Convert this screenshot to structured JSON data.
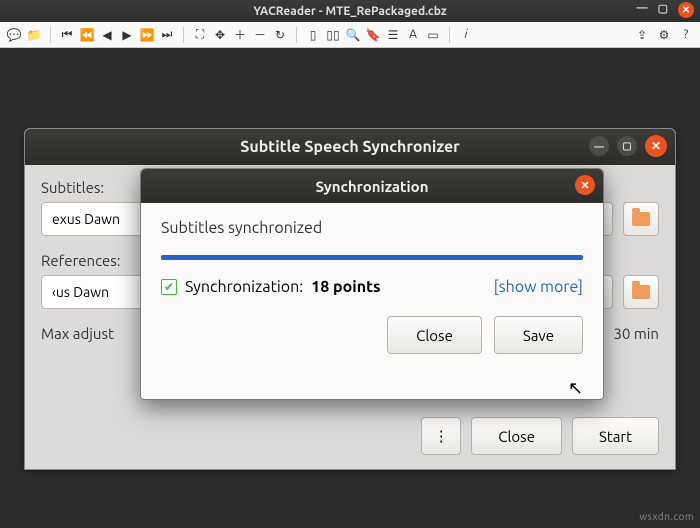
{
  "outer_window": {
    "title": "YACReader - MTE_RePackaged.cbz"
  },
  "sss_window": {
    "title": "Subtitle Speech Synchronizer",
    "subtitles_label": "Subtitles:",
    "subtitles_value": "exus Dawn",
    "references_label": "References:",
    "references_value": "‹us Dawn",
    "max_adjust_label": "Max adjust",
    "max_adjust_value": "30 min",
    "buttons": {
      "more": "⋮",
      "close": "Close",
      "start": "Start"
    }
  },
  "sync_dialog": {
    "title": "Synchronization",
    "message": "Subtitles synchronized",
    "status_prefix": "Synchronization:",
    "status_points": "18 points",
    "show_more": "[show more]",
    "buttons": {
      "close": "Close",
      "save": "Save"
    }
  },
  "watermark": "wsxdn.com"
}
